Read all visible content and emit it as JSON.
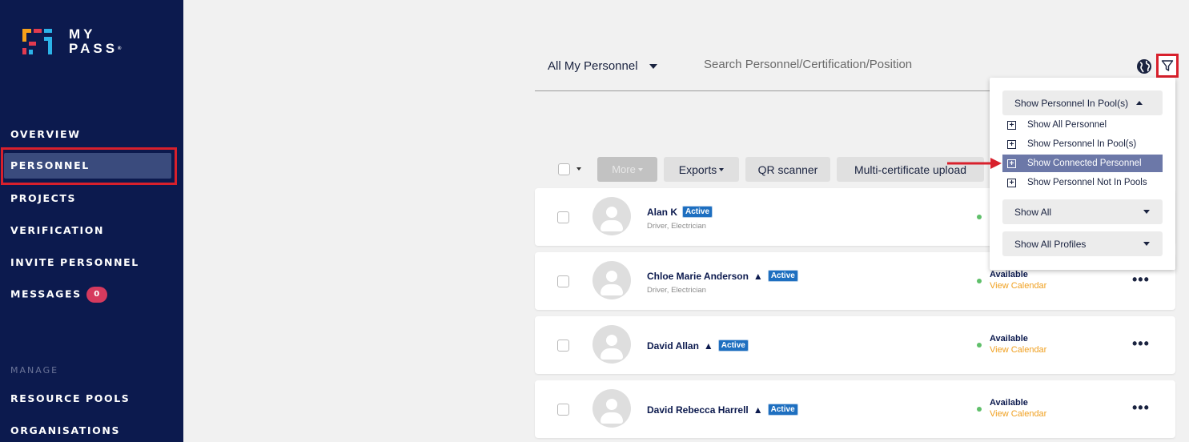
{
  "brand": {
    "line1": "MY",
    "line2": "PASS",
    "mark": "®"
  },
  "sidebar": {
    "items": [
      {
        "label": "OVERVIEW"
      },
      {
        "label": "PERSONNEL"
      },
      {
        "label": "PROJECTS"
      },
      {
        "label": "VERIFICATION"
      },
      {
        "label": "INVITE PERSONNEL"
      },
      {
        "label": "MESSAGES",
        "badge": "0"
      }
    ],
    "manage_label": "MANAGE",
    "manage_items": [
      {
        "label": "RESOURCE POOLS"
      },
      {
        "label": "ORGANISATIONS"
      }
    ]
  },
  "header": {
    "scope_label": "All My Personnel",
    "search_placeholder": "Search Personnel/Certification/Position"
  },
  "toolbar": {
    "more_label": "More",
    "exports_label": "Exports",
    "qr_label": "QR scanner",
    "multicert_label": "Multi-certificate upload"
  },
  "personnel": [
    {
      "name": "Alan K",
      "status": "Active",
      "roles": "Driver, Electrician",
      "warning": false,
      "availability": "",
      "calendar": ""
    },
    {
      "name": "Chloe Marie Anderson",
      "status": "Active",
      "roles": "Driver, Electrician",
      "warning": true,
      "availability": "Available",
      "calendar": "View Calendar"
    },
    {
      "name": "David Allan",
      "status": "Active",
      "roles": "",
      "warning": true,
      "availability": "Available",
      "calendar": "View Calendar"
    },
    {
      "name": "David Rebecca Harrell",
      "status": "Active",
      "roles": "",
      "warning": true,
      "availability": "Available",
      "calendar": "View Calendar"
    }
  ],
  "filter_menu": {
    "pool_header": "Show Personnel In Pool(s)",
    "options": [
      {
        "label": "Show All Personnel"
      },
      {
        "label": "Show Personnel In Pool(s)"
      },
      {
        "label": "Show Connected Personnel",
        "selected": true
      },
      {
        "label": "Show Personnel Not In Pools"
      }
    ],
    "show_all": "Show All",
    "show_profiles": "Show All Profiles"
  },
  "colors": {
    "sidebar_bg": "#0c1a4e",
    "highlight": "#d8202c",
    "tag": "#1e6fc0",
    "calendar_link": "#f0a020",
    "available_dot": "#5fbf6a"
  }
}
